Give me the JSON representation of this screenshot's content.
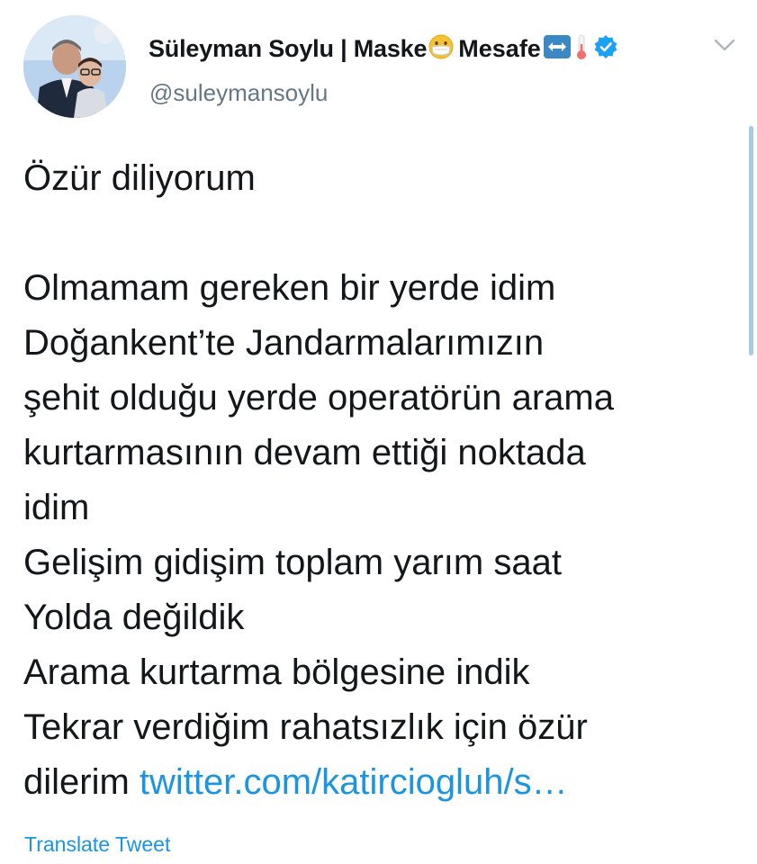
{
  "tweet": {
    "author": {
      "display_name": "Süleyman Soylu | Maske",
      "display_name_suffix": "Mesafe",
      "handle": "@suleymansoylu",
      "verified": true,
      "name_emojis": [
        "face-with-medical-mask-emoji",
        "left-right-arrow-emoji",
        "thermometer-emoji"
      ]
    },
    "text_lines": [
      "Özür diliyorum",
      "",
      "Olmamam gereken bir yerde idim",
      "Doğankent’te Jandarmalarımızın",
      "şehit olduğu yerde operatörün arama",
      "kurtarmasının devam ettiği noktada",
      "idim",
      "Gelişim gidişim toplam yarım saat",
      "Yolda değildik",
      "Arama kurtarma bölgesine indik",
      "Tekrar verdiğim rahatsızlık için özür"
    ],
    "last_line_text": "dilerim ",
    "link_text": "twitter.com/katirciogluh/s…",
    "translate_label": "Translate Tweet"
  },
  "colors": {
    "text": "#14171a",
    "handle": "#657786",
    "link": "#1b95e0",
    "verified": "#1da1f2"
  }
}
